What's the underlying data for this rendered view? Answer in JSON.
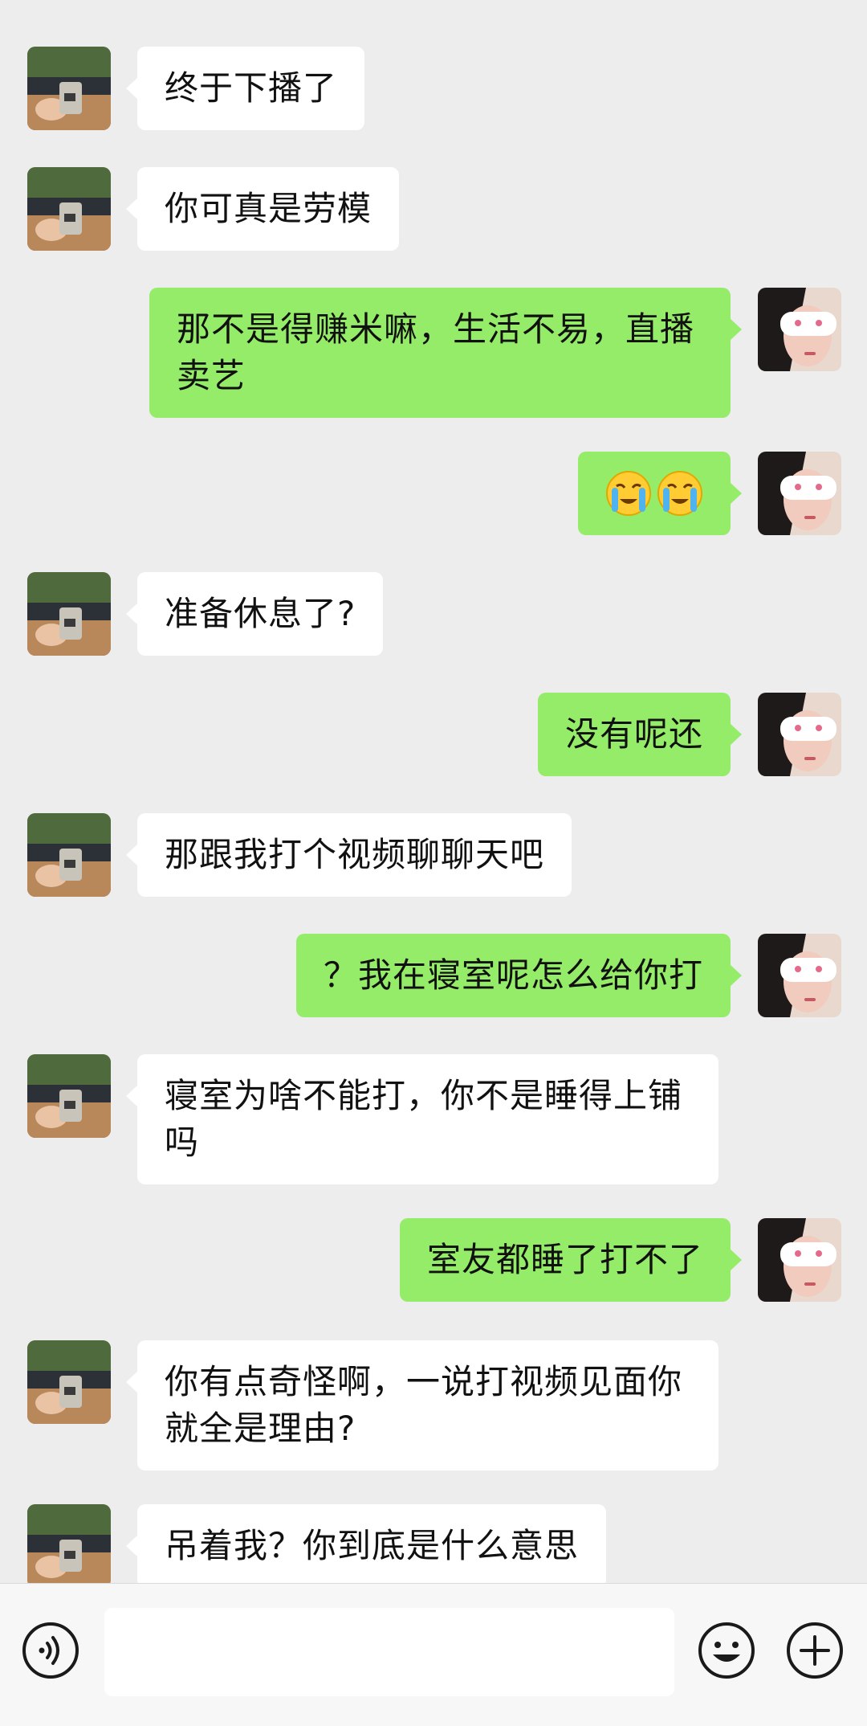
{
  "messages": [
    {
      "side": "in",
      "text": "终于下播了"
    },
    {
      "side": "in",
      "text": "你可真是劳模"
    },
    {
      "side": "out",
      "text": "那不是得赚米嘛，生活不易，直播卖艺"
    },
    {
      "side": "out",
      "emoji": [
        "loudly-crying-face",
        "loudly-crying-face"
      ]
    },
    {
      "side": "in",
      "text": "准备休息了?"
    },
    {
      "side": "out",
      "text": "没有呢还"
    },
    {
      "side": "in",
      "text": "那跟我打个视频聊聊天吧"
    },
    {
      "side": "out",
      "text": "？我在寝室呢怎么给你打"
    },
    {
      "side": "in",
      "text": "寝室为啥不能打，你不是睡得上铺吗"
    },
    {
      "side": "out",
      "text": "室友都睡了打不了"
    },
    {
      "side": "in",
      "text": "你有点奇怪啊，一说打视频见面你就全是理由?"
    },
    {
      "side": "in",
      "text": "吊着我？你到底是什么意思"
    }
  ],
  "input_bar": {
    "voice_icon": "voice-input-icon",
    "input_value": "",
    "emoji_icon": "emoji-smile-icon",
    "plus_icon": "plus-circle-icon"
  },
  "colors": {
    "background": "#EDEDED",
    "incoming_bubble": "#FFFFFF",
    "outgoing_bubble": "#95EC69"
  }
}
